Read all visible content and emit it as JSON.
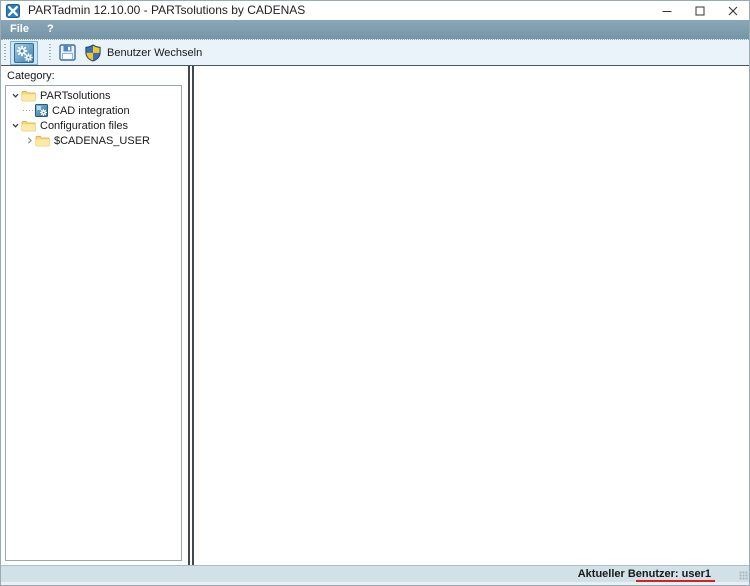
{
  "window": {
    "title": "PARTadmin 12.10.00 - PARTsolutions by CADENAS"
  },
  "menubar": {
    "items": [
      {
        "label": "File"
      },
      {
        "label": "?"
      }
    ]
  },
  "toolbar": {
    "buttons": [
      {
        "name": "category-admin",
        "icon": "gears-icon",
        "state": "checked"
      },
      {
        "name": "save",
        "icon": "save-icon"
      },
      {
        "name": "switch-user",
        "icon": "shield-icon",
        "label": "Benutzer Wechseln"
      }
    ],
    "switch_user_label": "Benutzer Wechseln"
  },
  "sidebar": {
    "category_label": "Category:",
    "tree": [
      {
        "label": "PARTsolutions",
        "icon": "folder-icon",
        "state": "expanded",
        "level": 0
      },
      {
        "label": "CAD integration",
        "icon": "cad-integration-icon",
        "state": "leaf",
        "level": 1
      },
      {
        "label": "Configuration files",
        "icon": "folder-icon",
        "state": "expanded",
        "level": 0
      },
      {
        "label": "$CADENAS_USER",
        "icon": "folder-icon",
        "state": "collapsed",
        "level": 1
      }
    ]
  },
  "statusbar": {
    "current_user": "Aktueller Benutzer: user1",
    "annotation": "red-underline"
  },
  "colors": {
    "menubar_bg": "#7b9cac",
    "toolbar_bg": "#e9f3f9",
    "statusbar_bg": "#d2e0e7",
    "annotation_red": "#e11c1c",
    "folder_yellow": "#ffd05e",
    "icon_blue": "#3d7fae",
    "shield_yellow": "#f6c623",
    "shield_blue": "#3a6fb8"
  }
}
